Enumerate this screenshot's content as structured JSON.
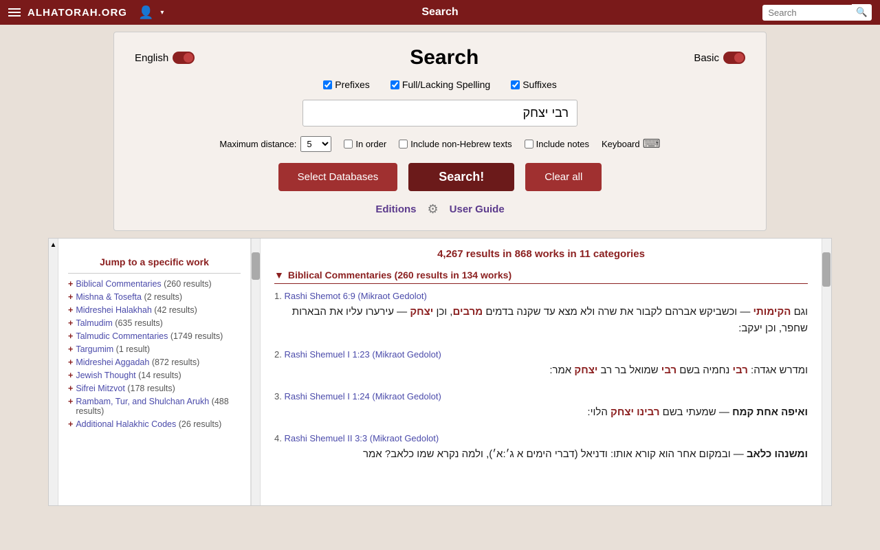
{
  "nav": {
    "site_title": "ALHATORAH.ORG",
    "center_title": "Search",
    "search_placeholder": "Search"
  },
  "lang_toggle": {
    "label": "English"
  },
  "basic_toggle": {
    "label": "Basic"
  },
  "search_panel": {
    "title": "Search",
    "checkboxes": [
      {
        "id": "prefixes",
        "label": "Prefixes",
        "checked": true
      },
      {
        "id": "fullspelling",
        "label": "Full/Lacking Spelling",
        "checked": true
      },
      {
        "id": "suffixes",
        "label": "Suffixes",
        "checked": true
      }
    ],
    "search_value": "רבי יצחק",
    "max_distance_label": "Maximum distance:",
    "max_distance_value": "5",
    "options": [
      {
        "id": "inorder",
        "label": "In order",
        "checked": false
      },
      {
        "id": "nonhebrew",
        "label": "Include non-Hebrew texts",
        "checked": false
      },
      {
        "id": "notes",
        "label": "Include notes",
        "checked": false
      }
    ],
    "keyboard_label": "Keyboard",
    "btn_select_db": "Select Databases",
    "btn_search": "Search!",
    "btn_clear": "Clear all"
  },
  "footer": {
    "editions_label": "Editions",
    "user_guide_label": "User Guide"
  },
  "results": {
    "summary": "4,267 results in 868 works in 11 categories",
    "category_header": "Biblical Commentaries (260 results in 134 works)",
    "items": [
      {
        "number": "1.",
        "source": "Rashi Shemot 6:9 (Mikraot Gedolot)",
        "text": "וגם הקימותי — וכשביקש אברהם לקבור את שרה ולא מצא עד שקנה בדמים מרבים, וכן יצחק — עירערו עליו את הבארות שחפר, וכן יעקב:"
      },
      {
        "number": "2.",
        "source": "Rashi Shemuel I 1:23 (Mikraot Gedolot)",
        "text": "ומדרש אגדה: רבי נחמיה בשם רבי שמואל בר רב יצחק אמר:"
      },
      {
        "number": "3.",
        "source": "Rashi Shemuel I 1:24 (Mikraot Gedolot)",
        "text": "ואיפה אחת קמח — שמעתי בשם רבינו יצחק הלוי:"
      },
      {
        "number": "4.",
        "source": "Rashi Shemuel II 3:3 (Mikraot Gedolot)",
        "text": "ומשנהו כלאב — ובמקום אחר הוא קורא אותו: ודניאל (דברי הימים א גיאי), ולמה נקרא שמו כלאב? אמר"
      }
    ]
  },
  "sidebar": {
    "title": "Jump to a specific work",
    "items": [
      {
        "label": "Biblical Commentaries",
        "count": "(260 results)"
      },
      {
        "label": "Mishna & Tosefta",
        "count": "(2 results)"
      },
      {
        "label": "Midreshei Halakhah",
        "count": "(42 results)"
      },
      {
        "label": "Talmudim",
        "count": "(635 results)"
      },
      {
        "label": "Talmudic Commentaries",
        "count": "(1749 results)"
      },
      {
        "label": "Targumim",
        "count": "(1 result)"
      },
      {
        "label": "Midreshei Aggadah",
        "count": "(872 results)"
      },
      {
        "label": "Jewish Thought",
        "count": "(14 results)"
      },
      {
        "label": "Sifrei Mitzvot",
        "count": "(178 results)"
      },
      {
        "label": "Rambam, Tur, and Shulchan Arukh",
        "count": "(488 results)"
      },
      {
        "label": "Additional Halakhic Codes",
        "count": "(26 results)"
      }
    ]
  }
}
